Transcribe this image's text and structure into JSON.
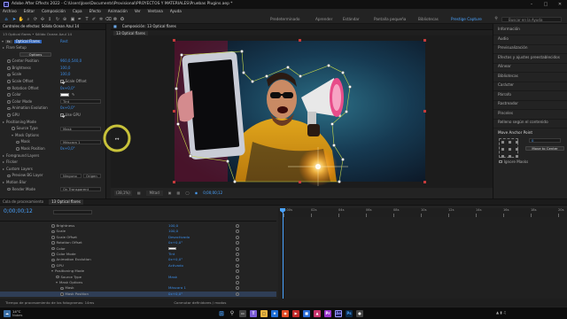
{
  "window": {
    "title": "Adobe After Effects 2022 - C:\\Users\\Jose\\Documents\\Provisional\\PROYECTOS Y MATERIALES\\Pruebas Plugins.aep *"
  },
  "menu": [
    "Archivo",
    "Editar",
    "Composición",
    "Capa",
    "Efecto",
    "Animación",
    "Ver",
    "Ventana",
    "Ayuda"
  ],
  "workspaces": [
    {
      "label": "Predeterminado",
      "active": false
    },
    {
      "label": "Aprender",
      "active": false
    },
    {
      "label": "Estándar",
      "active": false
    },
    {
      "label": "Pantalla pequeña",
      "active": false
    },
    {
      "label": "Bibliotecas",
      "active": false
    },
    {
      "label": "Prestige Capture",
      "active": true
    }
  ],
  "search": {
    "placeholder": "Buscar en la Ayuda"
  },
  "effect_controls": {
    "tabs": [
      "Controles de efectos: Sólido Ocean Azul 14"
    ],
    "subtitle": "13 Optical flares • Sólido Ocean Azul 14",
    "effect_name": "Optical Flares",
    "reset_label": "Rest",
    "rows": [
      {
        "label": "Flare Setup",
        "type": "section",
        "value": ""
      },
      {
        "label": "Options",
        "type": "button",
        "value": ""
      },
      {
        "label": "Center Position",
        "type": "prop",
        "value": "960,0,540,0"
      },
      {
        "label": "Brightness",
        "type": "prop",
        "value": "100,0"
      },
      {
        "label": "Scale",
        "type": "prop",
        "value": "100,0"
      },
      {
        "label": "Scale Offset",
        "type": "checkbox",
        "value": "Scale Offset"
      },
      {
        "label": "Rotation Offset",
        "type": "prop",
        "value": "0x+0,0°"
      },
      {
        "label": "Color",
        "type": "color",
        "value": ""
      },
      {
        "label": "Color Mode",
        "type": "dropdown",
        "value": "Tint"
      },
      {
        "label": "Animation Evolution",
        "type": "prop",
        "value": "0x+0,0°"
      },
      {
        "label": "GPU",
        "type": "checkbox",
        "value": "Use GPU"
      },
      {
        "label": "Positioning Mode",
        "type": "section",
        "value": ""
      },
      {
        "label": "Source Type",
        "type": "dropdown",
        "value": "Mask"
      },
      {
        "label": "Mask Options",
        "type": "subsection",
        "value": ""
      },
      {
        "label": "Mask",
        "type": "dropdown",
        "value": "Máscara 1"
      },
      {
        "label": "Mask Position",
        "type": "prop",
        "value": "0x+0,0°"
      },
      {
        "label": "Foreground Layers",
        "type": "section",
        "value": ""
      },
      {
        "label": "Flicker",
        "type": "section",
        "value": ""
      },
      {
        "label": "Custom Layers",
        "type": "section",
        "value": ""
      },
      {
        "label": "Preview BG Layer",
        "type": "dropdown2",
        "value": "Ninguno",
        "value2": "Origen"
      },
      {
        "label": "Motion Blur",
        "type": "section",
        "value": ""
      },
      {
        "label": "Render Mode",
        "type": "dropdown",
        "value": "On Transparent"
      }
    ]
  },
  "composition": {
    "tab": "Composición: 13 Optical flares",
    "subtab": "13 Optical flares",
    "zoom": "(38,1%)",
    "quality": "Mitad",
    "timecode": "0;00;00;12"
  },
  "right_panel": {
    "items": [
      "Información",
      "Audio",
      "Previsualización",
      "Efectos y ajustes preestablecidos",
      "Alinear",
      "Bibliotecas",
      "Carácter",
      "Párrafo",
      "Rastreador",
      "Pinceles",
      "Relleno según el contenido"
    ],
    "anchor": {
      "title": "Move Anchor Point",
      "value": "0",
      "button": "Move to Center",
      "ignore": "Ignore Masks"
    }
  },
  "timeline": {
    "tabs": [
      "Cola de procesamiento",
      "13 Optical flares"
    ],
    "timecode": "0;00;00;12",
    "rows": [
      {
        "label": "Brightness",
        "value": "100,0"
      },
      {
        "label": "Scale",
        "value": "100,0"
      },
      {
        "label": "Scale Offset",
        "value": "Desactivado"
      },
      {
        "label": "Rotation Offset",
        "value": "0x+0,0°"
      },
      {
        "label": "Color",
        "value": ""
      },
      {
        "label": "Color Mode",
        "value": "Tint"
      },
      {
        "label": "Animation Evolution",
        "value": "0x+0,0°"
      },
      {
        "label": "GPU",
        "value": "Activado"
      },
      {
        "label": "Positioning Mode",
        "value": ""
      },
      {
        "label": "Source Type",
        "value": "Mask"
      },
      {
        "label": "Mask Options",
        "value": ""
      },
      {
        "label": "Mask",
        "value": "Máscara 1"
      },
      {
        "label": "Mask Position",
        "value": "0x+0,0°"
      }
    ],
    "ruler": [
      "0:00s",
      "02s",
      "04s",
      "06s",
      "08s",
      "10s",
      "12s",
      "14s",
      "16s",
      "18s",
      "20s"
    ],
    "footer_left": "Tiempo de procesamiento de los fotogramas: 14ms",
    "footer_mid": "Conmutar definidores / modos"
  },
  "taskbar": {
    "weather": "Nubes",
    "temp": "14°C"
  }
}
